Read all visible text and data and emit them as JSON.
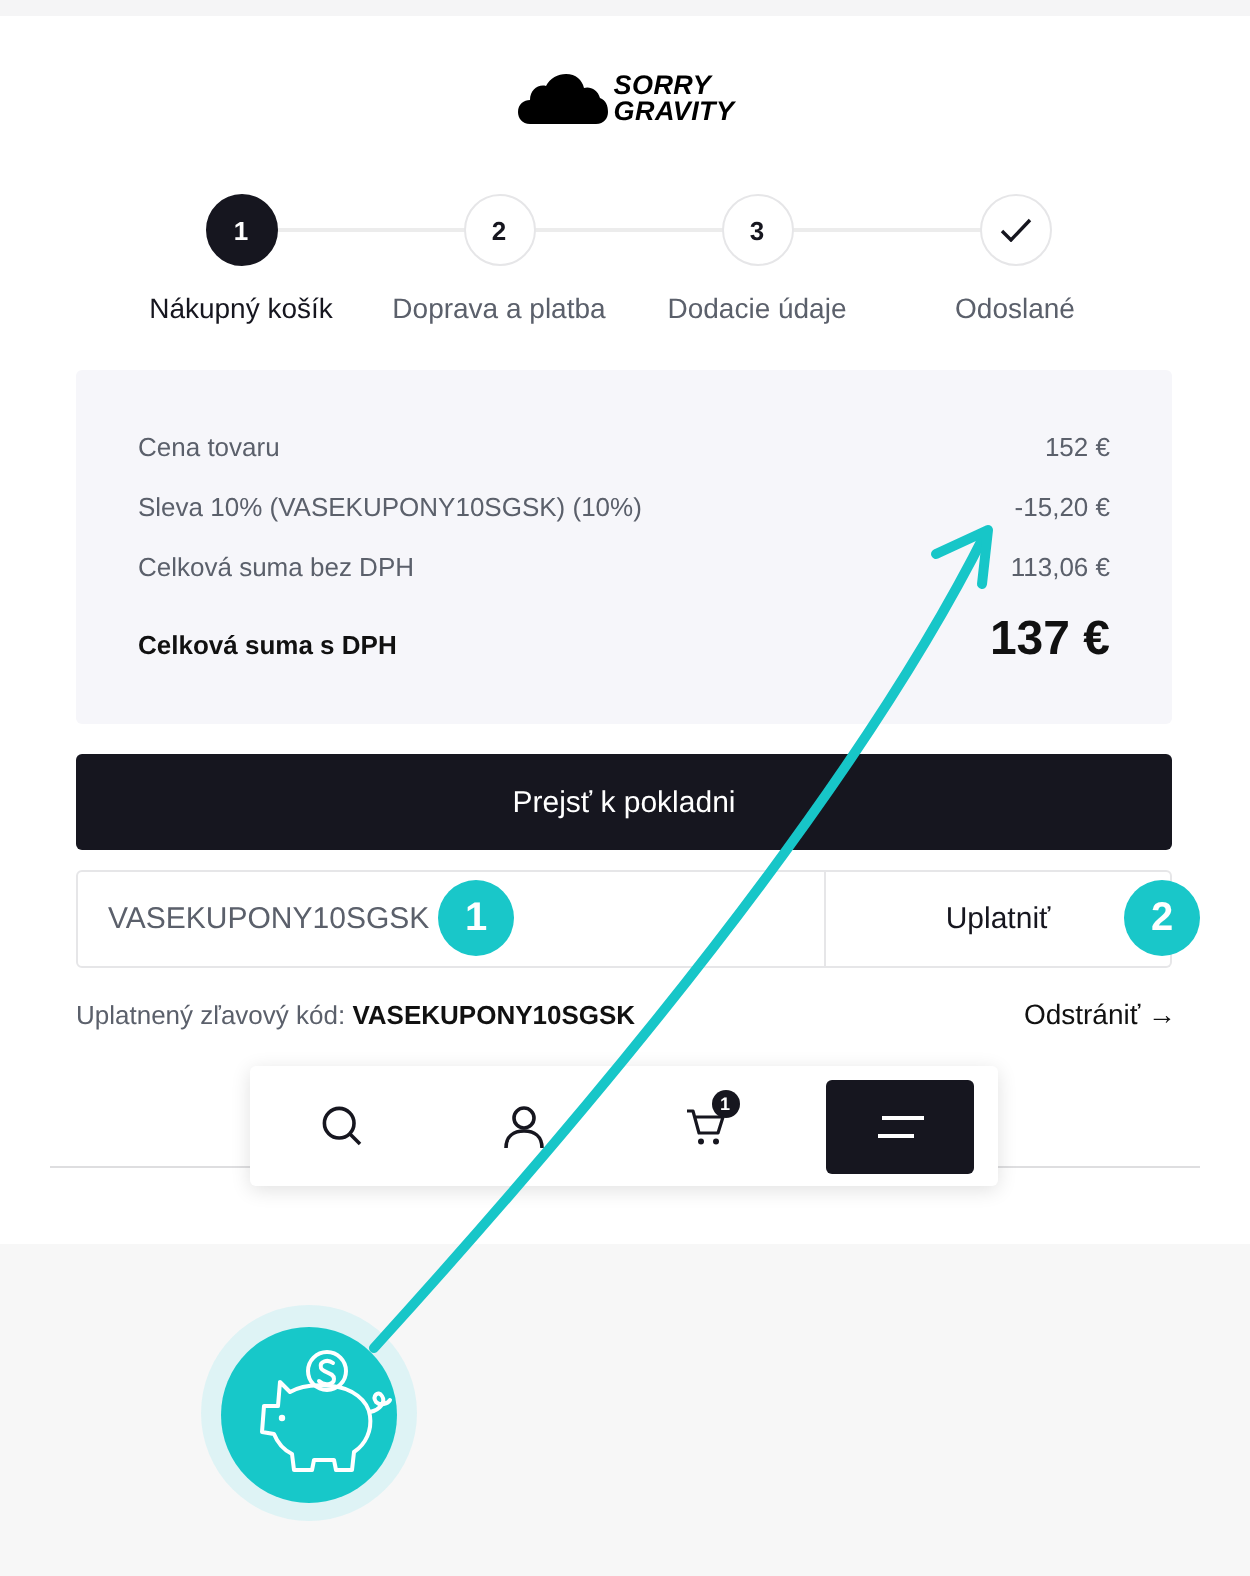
{
  "logo": {
    "lines": [
      "SORRY",
      "GRAVITY"
    ]
  },
  "steps": [
    {
      "kind": "number",
      "number": "1",
      "label": "Nákupný košík",
      "selected": true
    },
    {
      "kind": "number",
      "number": "2",
      "label": "Doprava a platba",
      "selected": false
    },
    {
      "kind": "number",
      "number": "3",
      "label": "Dodacie údaje",
      "selected": false
    },
    {
      "kind": "check",
      "label": "Odoslané",
      "selected": false
    }
  ],
  "summary": {
    "rows": [
      {
        "label": "Cena tovaru",
        "value": "152 €"
      },
      {
        "label": "Sleva 10% (VASEKUPONY10SGSK) (10%)",
        "value": "-15,20 €"
      },
      {
        "label": "Celková suma bez DPH",
        "value": "113,06 €"
      }
    ],
    "total": {
      "label": "Celková suma s DPH",
      "value": "137 €"
    }
  },
  "checkout_button": "Prejsť k pokladni",
  "coupon": {
    "value": "VASEKUPONY10SGSK",
    "value_marker": "1",
    "apply_button": "Uplatniť",
    "apply_marker": "2"
  },
  "applied_code": {
    "text": "Uplatnený zľavový kód: **VASEKUPONY10SGSK**",
    "remove_link": "Odstrániť →"
  },
  "bottom_nav": [
    {
      "kind": "search"
    },
    {
      "kind": "account"
    },
    {
      "kind": "cart",
      "badge": "1"
    },
    {
      "kind": "menu"
    }
  ]
}
